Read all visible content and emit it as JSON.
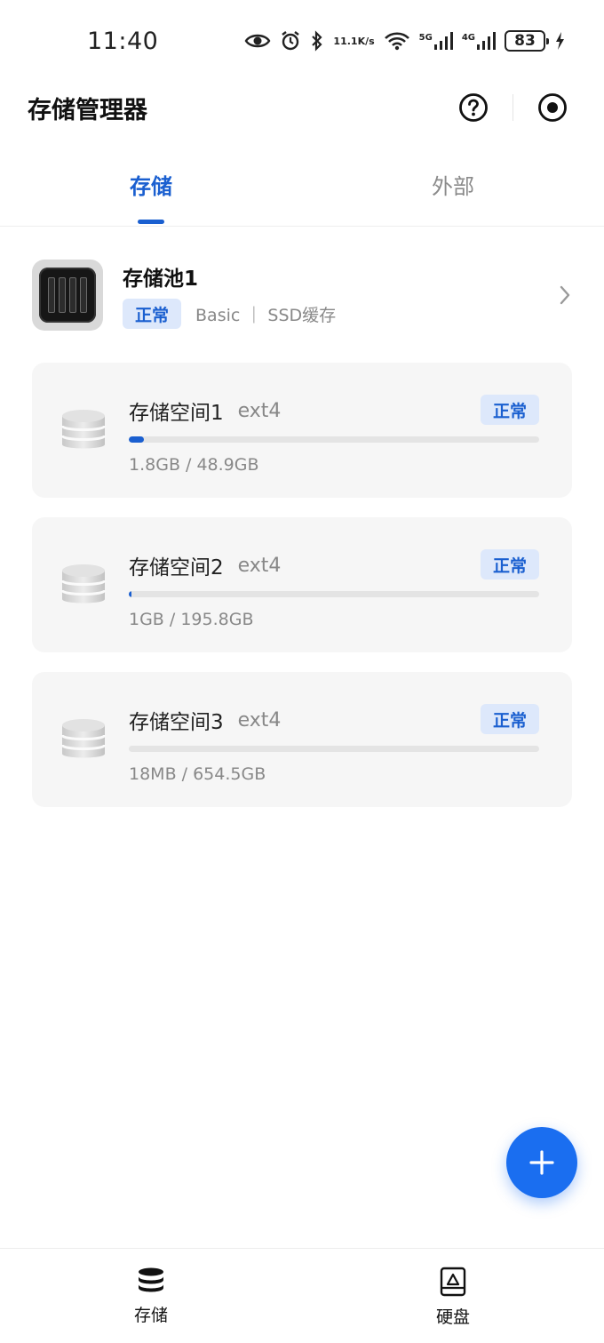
{
  "status_bar": {
    "time": "11:40",
    "net_speed_value": "11.1",
    "net_speed_unit": "K/s",
    "signal1_label": "5G",
    "signal2_label": "4G",
    "battery": "83"
  },
  "header": {
    "title": "存储管理器",
    "help_icon": "help-circle-icon",
    "record_icon": "record-target-icon"
  },
  "tabs": [
    {
      "label": "存储",
      "active": true
    },
    {
      "label": "外部",
      "active": false
    }
  ],
  "pool": {
    "name": "存储池1",
    "status": "正常",
    "description": "Basic ｜ SSD缓存"
  },
  "volumes": [
    {
      "name": "存储空间1",
      "fs": "ext4",
      "status": "正常",
      "usage": "1.8GB / 48.9GB",
      "used_fraction": 0.037
    },
    {
      "name": "存储空间2",
      "fs": "ext4",
      "status": "正常",
      "usage": "1GB / 195.8GB",
      "used_fraction": 0.005
    },
    {
      "name": "存储空间3",
      "fs": "ext4",
      "status": "正常",
      "usage": "18MB / 654.5GB",
      "used_fraction": 0.0
    }
  ],
  "bottom_nav": [
    {
      "label": "存储",
      "icon": "database-icon"
    },
    {
      "label": "硬盘",
      "icon": "hard-disk-icon"
    }
  ],
  "colors": {
    "accent": "#1a5fd0",
    "fab": "#1a6ef0",
    "badge_bg": "#dde8fb",
    "card_bg": "#f6f6f6"
  }
}
